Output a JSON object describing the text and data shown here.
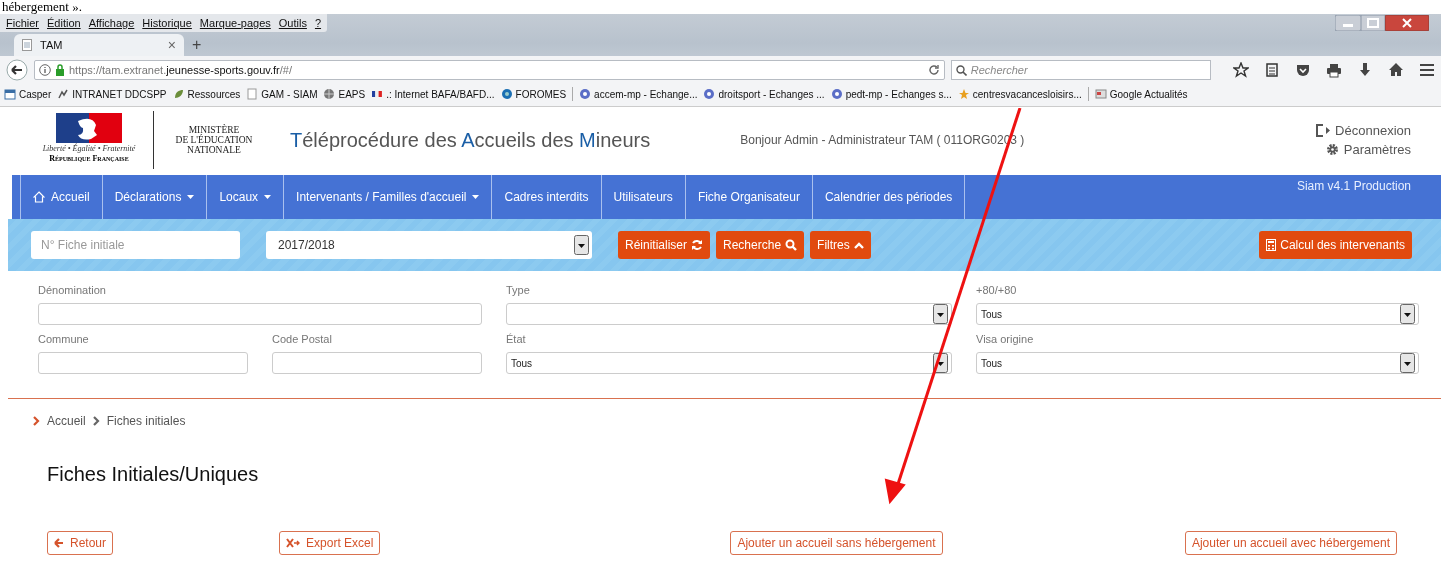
{
  "document_fragment": "hébergement ».",
  "browser": {
    "menu": [
      "Fichier",
      "Édition",
      "Affichage",
      "Historique",
      "Marque-pages",
      "Outils",
      "?"
    ],
    "tab": {
      "title": "TAM",
      "close": "×"
    },
    "new_tab": "+",
    "url": {
      "prefix": "https://tam.extranet.",
      "domain": "jeunesse-sports.gouv.fr",
      "suffix": "/#/"
    },
    "search_placeholder": "Rechercher",
    "bookmarks": [
      "Casper",
      "INTRANET DDCSPP",
      "Ressources",
      "GAM - SIAM",
      "EAPS",
      ".: Internet BAFA/BAFD...",
      "FOROMES",
      "accem-mp - Echange...",
      "droitsport - Echanges ...",
      "pedt-mp - Echanges s...",
      "centresvacancesloisirs...",
      "Google Actualités"
    ]
  },
  "header": {
    "logo_motto": "Liberté • Égalité • Fraternité",
    "logo_caption": "République Française",
    "ministry": [
      "MINISTÈRE",
      "DE L'ÉDUCATION",
      "NATIONALE"
    ],
    "title": [
      {
        "text": "T",
        "accent": true
      },
      {
        "text": "éléprocédure des ",
        "accent": false
      },
      {
        "text": "A",
        "accent": true
      },
      {
        "text": "ccueils des ",
        "accent": false
      },
      {
        "text": "M",
        "accent": true
      },
      {
        "text": "ineurs",
        "accent": false
      }
    ],
    "greeting": "Bonjour Admin - Administrateur TAM ( 011ORG0203 )",
    "logout": "Déconnexion",
    "settings": "Paramètres"
  },
  "nav": {
    "items": [
      {
        "label": "Accueil",
        "dropdown": false,
        "home": true
      },
      {
        "label": "Déclarations",
        "dropdown": true,
        "home": false
      },
      {
        "label": "Locaux",
        "dropdown": true,
        "home": false
      },
      {
        "label": "Intervenants / Familles d'accueil",
        "dropdown": true,
        "home": false
      },
      {
        "label": "Cadres interdits",
        "dropdown": false,
        "home": false
      },
      {
        "label": "Utilisateurs",
        "dropdown": false,
        "home": false
      },
      {
        "label": "Fiche Organisateur",
        "dropdown": false,
        "home": false
      },
      {
        "label": "Calendrier des périodes",
        "dropdown": false,
        "home": false
      }
    ],
    "version": "Siam v4.1 Production"
  },
  "filter_bar": {
    "number_placeholder": "N° Fiche initiale",
    "year": "2017/2018",
    "reset": "Réinitialiser",
    "search": "Recherche",
    "filters": "Filtres",
    "compute": "Calcul des intervenants"
  },
  "form": {
    "fields": [
      {
        "label": "Dénomination",
        "kind": "text"
      },
      {
        "label": "Type",
        "kind": "select"
      },
      {
        "label": "+80/+80",
        "kind": "select",
        "value": "Tous"
      },
      {
        "label": "Commune",
        "kind": "text"
      },
      {
        "label": "Code Postal",
        "kind": "text"
      },
      {
        "label": "État",
        "kind": "select",
        "value": "Tous"
      },
      {
        "label": "Visa origine",
        "kind": "select",
        "value": "Tous"
      }
    ]
  },
  "breadcrumb": [
    "Accueil",
    "Fiches initiales"
  ],
  "page_title": "Fiches Initiales/Uniques",
  "actions": [
    {
      "label": "Retour",
      "kind": "back"
    },
    {
      "label": "Export Excel",
      "kind": "export"
    },
    {
      "label": "Ajouter un accueil sans hébergement",
      "kind": "plain"
    },
    {
      "label": "Ajouter un accueil avec hébergement",
      "kind": "plain"
    }
  ]
}
